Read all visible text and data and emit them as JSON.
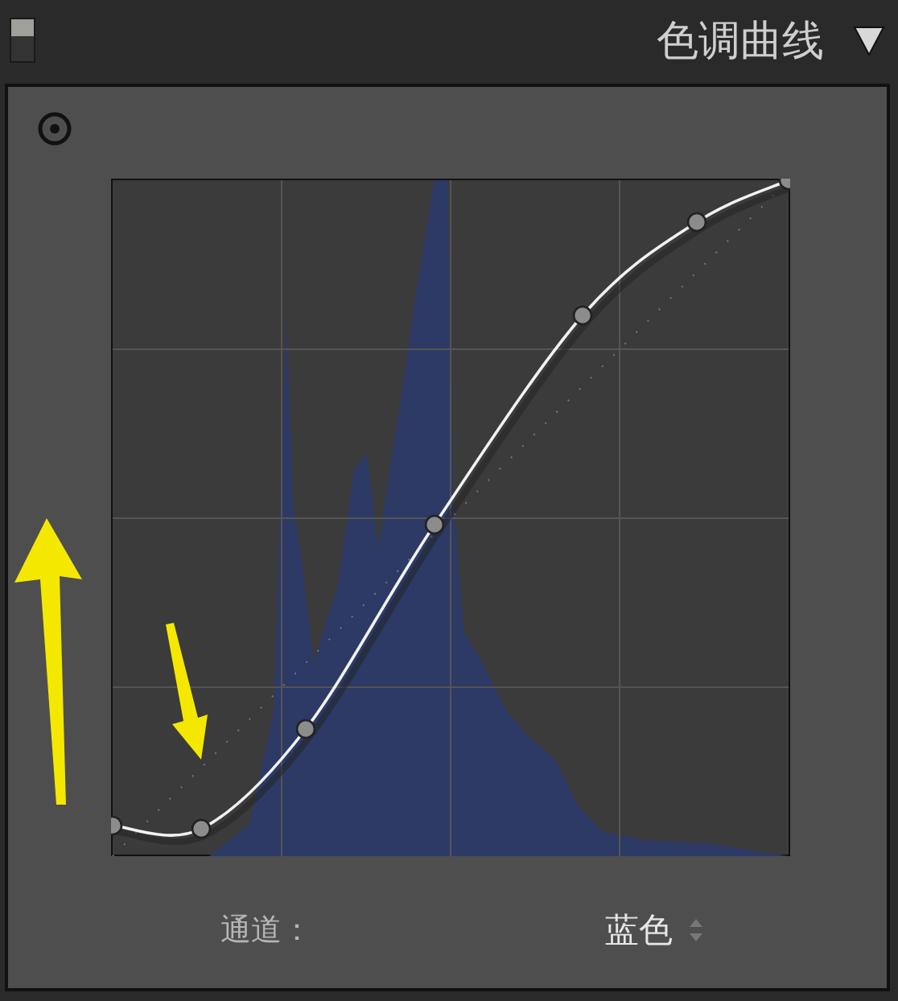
{
  "panel": {
    "title": "色调曲线"
  },
  "channel": {
    "label": "通道：",
    "value": "蓝色"
  }
}
